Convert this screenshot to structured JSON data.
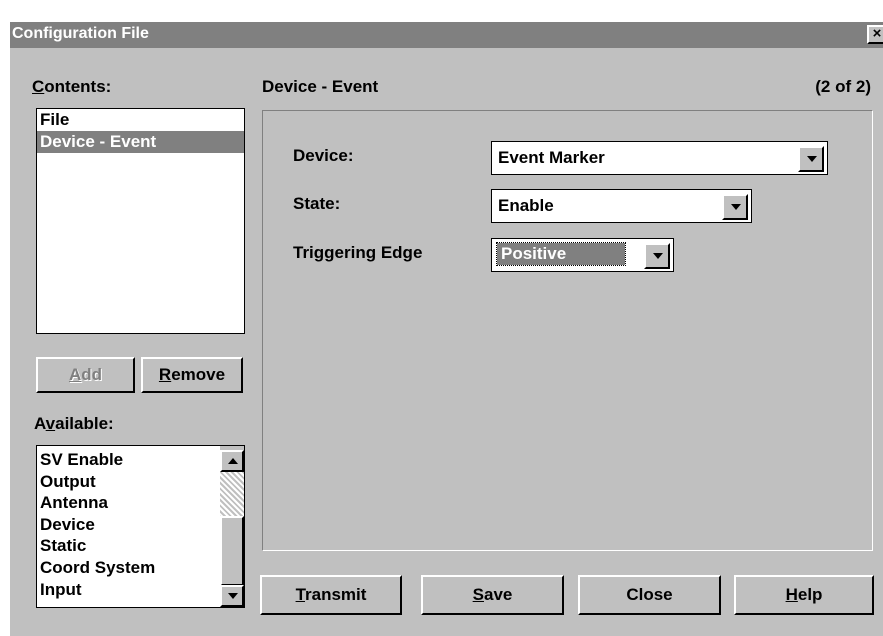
{
  "window": {
    "title": "Configuration File",
    "close_glyph": "×"
  },
  "contents": {
    "label": "Contents:",
    "items": [
      "File",
      "Device - Event"
    ],
    "selected_index": 1
  },
  "buttons": {
    "add": "Add",
    "remove": "Remove"
  },
  "available": {
    "label": "Available:",
    "items": [
      "SV Enable",
      "Output",
      "Antenna",
      "Device",
      "Static",
      "Coord System",
      "Input"
    ]
  },
  "page": {
    "section_title": "Device - Event",
    "page_indicator": "(2 of 2)"
  },
  "fields": {
    "device": {
      "label": "Device:",
      "value": "Event Marker"
    },
    "state": {
      "label": "State:",
      "value": "Enable"
    },
    "triggering_edge": {
      "label": "Triggering Edge",
      "value": "Positive"
    }
  },
  "footer": {
    "transmit": "Transmit",
    "save": "Save",
    "close": "Close",
    "help": "Help"
  },
  "icons": {
    "close": "close-icon",
    "dropdown": "chevron-down-icon",
    "scroll_up": "scroll-up-icon",
    "scroll_down": "scroll-down-icon"
  },
  "colors": {
    "titlebar": "#808080",
    "face": "#c0c0c0",
    "selection": "#808080"
  }
}
